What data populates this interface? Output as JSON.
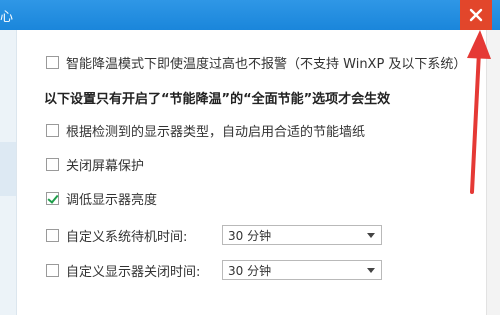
{
  "window": {
    "title_fragment": "心",
    "close_icon": "close-x-icon",
    "colors": {
      "titlebar": "#1a86db",
      "close": "#e2462b",
      "annotation_arrow": "#e53935"
    }
  },
  "options": {
    "smart_cooling_warning": {
      "label": "智能降温模式下即使温度过高也不报警（不支持 WinXP 及以下系统）",
      "checked": false
    },
    "section_heading": "以下设置只有开启了“节能降温”的“全面节能”选项才会生效",
    "auto_wallpaper": {
      "label": "根据检测到的显示器类型，自动启用合适的节能墙纸",
      "checked": false
    },
    "disable_screensaver": {
      "label": "关闭屏幕保护",
      "checked": false
    },
    "lower_brightness": {
      "label": "调低显示器亮度",
      "checked": true
    },
    "standby_time": {
      "label": "自定义系统待机时间:",
      "checked": false,
      "value": "30 分钟"
    },
    "monitor_off_time": {
      "label": "自定义显示器关闭时间:",
      "checked": false,
      "value": "30 分钟"
    }
  }
}
